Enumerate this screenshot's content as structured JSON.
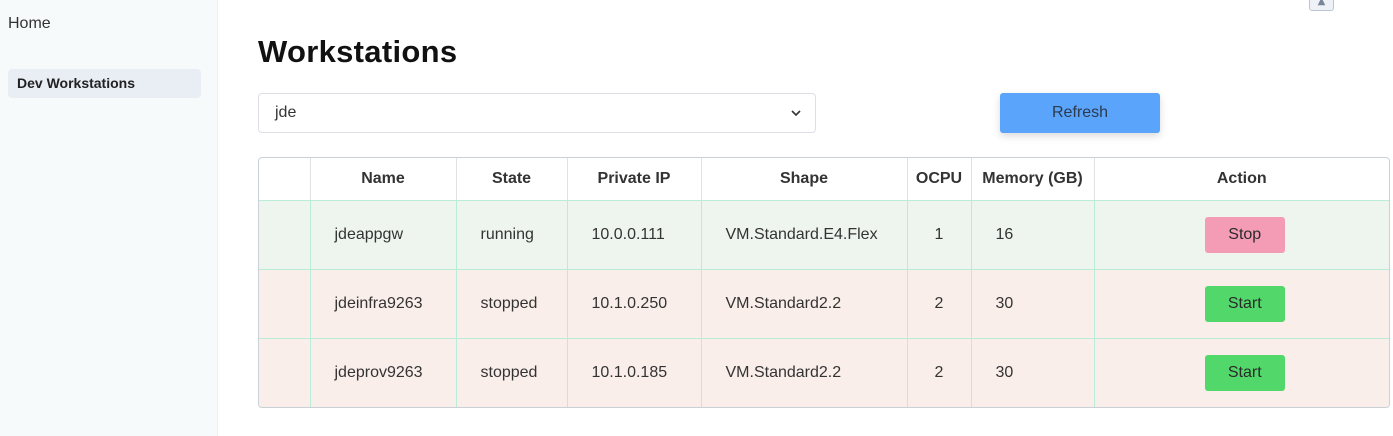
{
  "sidebar": {
    "home_label": "Home",
    "active_label": "Dev Workstations"
  },
  "scroll_top_icon": "double-chevron-up-icon",
  "page": {
    "title": "Workstations",
    "compartment_select": {
      "value": "jde",
      "icon": "chevron-down-icon"
    },
    "refresh_label": "Refresh"
  },
  "table": {
    "headers": [
      "",
      "Name",
      "State",
      "Private IP",
      "Shape",
      "OCPU",
      "Memory (GB)",
      "Action"
    ],
    "rows": [
      {
        "name": "jdeappgw",
        "state": "running",
        "private_ip": "10.0.0.111",
        "shape": "VM.Standard.E4.Flex",
        "ocpu": "1",
        "memory": "16",
        "action": "Stop"
      },
      {
        "name": "jdeinfra9263",
        "state": "stopped",
        "private_ip": "10.1.0.250",
        "shape": "VM.Standard2.2",
        "ocpu": "2",
        "memory": "30",
        "action": "Start"
      },
      {
        "name": "jdeprov9263",
        "state": "stopped",
        "private_ip": "10.1.0.185",
        "shape": "VM.Standard2.2",
        "ocpu": "2",
        "memory": "30",
        "action": "Start"
      }
    ]
  },
  "colors": {
    "refresh": "#5aa4fb",
    "stop_button": "#f49cb6",
    "start_button": "#52d86a",
    "row_running": "#eef5ef",
    "row_stopped": "#faeeea"
  }
}
